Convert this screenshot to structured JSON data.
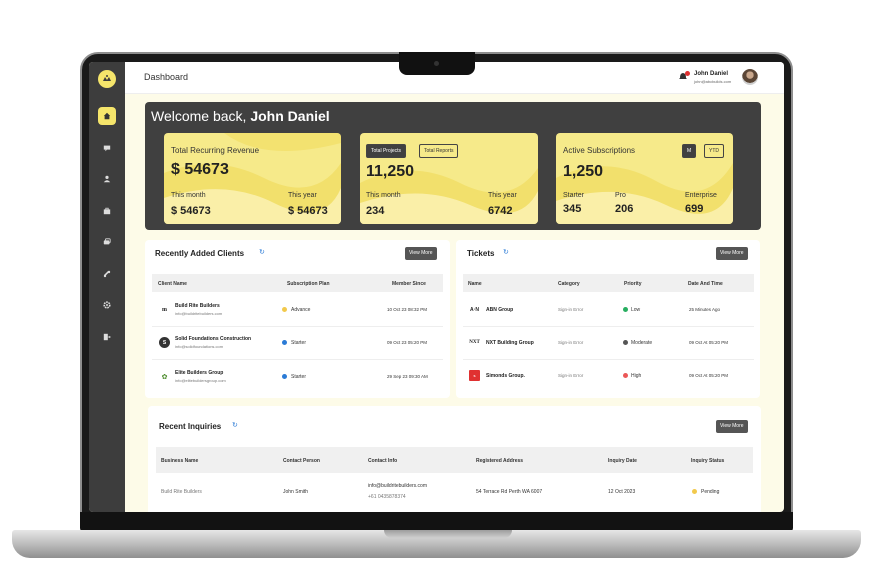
{
  "header": {
    "page_title": "Dashboard",
    "user_name": "John Daniel",
    "user_email": "john@abcbuilds.com"
  },
  "sidebar": {
    "items": [
      {
        "icon": "home-icon",
        "active": true
      },
      {
        "icon": "chat-icon",
        "active": false
      },
      {
        "icon": "users-icon",
        "active": false
      },
      {
        "icon": "briefcase-icon",
        "active": false
      },
      {
        "icon": "cards-icon",
        "active": false
      },
      {
        "icon": "link-icon",
        "active": false
      },
      {
        "icon": "gear-icon",
        "active": false
      },
      {
        "icon": "logout-icon",
        "active": false
      }
    ]
  },
  "welcome": {
    "greeting": "Welcome back, ",
    "name": "John Daniel"
  },
  "revenue_card": {
    "title": "Total Recurring Revenue",
    "total": "$ 54673",
    "this_month_label": "This month",
    "this_month_value": "$ 54673",
    "this_year_label": "This year",
    "this_year_value": "$ 54673"
  },
  "projects_card": {
    "tab_projects": "Total Projects",
    "tab_reports": "Total Reports",
    "total": "11,250",
    "this_month_label": "This month",
    "this_month_value": "234",
    "this_year_label": "This year",
    "this_year_value": "6742"
  },
  "subs_card": {
    "title": "Active Subscriptions",
    "toggle_m": "M",
    "toggle_ytd": "YTD",
    "total": "1,250",
    "starter_label": "Starter",
    "starter_value": "345",
    "pro_label": "Pro",
    "pro_value": "206",
    "enterprise_label": "Enterprise",
    "enterprise_value": "699"
  },
  "clients": {
    "title": "Recently Added Clients",
    "view_more": "View More",
    "columns": [
      "Client Name",
      "Subscription Plan",
      "Member Since"
    ],
    "rows": [
      {
        "name": "Build Rite Builders",
        "email": "info@buildritebuilders.com",
        "plan": "Advance",
        "plan_color": "#f2c94c",
        "since": "10 Oct 23 08:32 PM"
      },
      {
        "name": "Solid Foundations Construction",
        "email": "info@solidfoundations.com",
        "plan": "Starter",
        "plan_color": "#2b7bd6",
        "since": "09 Oct 23 05:20 PM"
      },
      {
        "name": "Elite Builders Group",
        "email": "info@elitebuildersgroup.com",
        "plan": "Starter",
        "plan_color": "#2b7bd6",
        "since": "29 Sep 23 09:30 AM"
      }
    ]
  },
  "tickets": {
    "title": "Tickets",
    "view_more": "View More",
    "columns": [
      "Name",
      "Category",
      "Priority",
      "Date And Time"
    ],
    "rows": [
      {
        "name": "ABN Group",
        "category": "Sign-in Error",
        "priority": "Low",
        "priority_color": "#27ae60",
        "date": "25 Minutes Ago"
      },
      {
        "name": "NXT Building Group",
        "category": "Sign-in Error",
        "priority": "Moderate",
        "priority_color": "#555555",
        "date": "09 Oct At 05:20 PM"
      },
      {
        "name": "Simonds Group.",
        "category": "Sign-in Error",
        "priority": "High",
        "priority_color": "#eb5757",
        "date": "09 Oct At 05:20 PM"
      }
    ]
  },
  "inquiries": {
    "title": "Recent Inquiries",
    "view_more": "View More",
    "columns": [
      "Business Name",
      "Contact Person",
      "Contact Info",
      "Registered Address",
      "Inquiry Date",
      "Inquiry Status"
    ],
    "rows": [
      {
        "business": "Build Rite Builders",
        "contact": "John Smith",
        "email": "info@buildritebuilders.com",
        "phone": "+61 0435878374",
        "address": "54 Terrace Rd Perth WA 6007",
        "date": "12 Oct 2023",
        "status": "Pending",
        "status_color": "#f2c94c"
      }
    ]
  }
}
